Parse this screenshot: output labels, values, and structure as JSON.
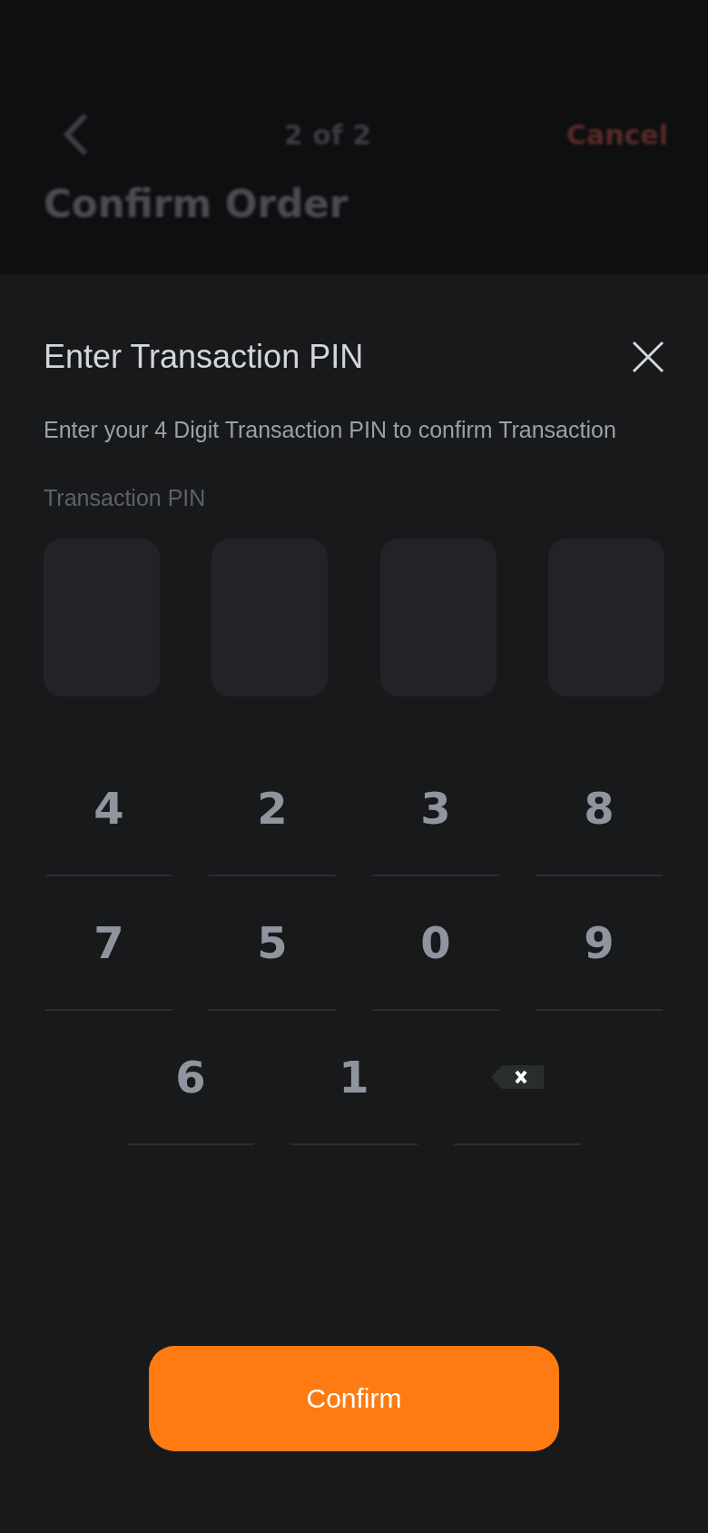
{
  "header": {
    "step": "2 of 2",
    "cancel": "Cancel",
    "title": "Confirm Order"
  },
  "sheet": {
    "title": "Enter Transaction PIN",
    "description": "Enter your 4 Digit Transaction PIN to confirm Transaction",
    "pin_label": "Transaction PIN",
    "pin_boxes": [
      {
        "filled": false
      },
      {
        "filled": false
      },
      {
        "filled": false
      },
      {
        "filled": false
      }
    ],
    "keypad": {
      "rows": [
        [
          {
            "kind": "digit",
            "label": "4"
          },
          {
            "kind": "digit",
            "label": "2"
          },
          {
            "kind": "digit",
            "label": "3"
          },
          {
            "kind": "digit",
            "label": "8"
          }
        ],
        [
          {
            "kind": "digit",
            "label": "7"
          },
          {
            "kind": "digit",
            "label": "5"
          },
          {
            "kind": "digit",
            "label": "0"
          },
          {
            "kind": "digit",
            "label": "9"
          }
        ],
        [
          {
            "kind": "digit",
            "label": "6"
          },
          {
            "kind": "digit",
            "label": "1"
          },
          {
            "kind": "backspace"
          }
        ]
      ]
    },
    "confirm_button": "Confirm"
  }
}
